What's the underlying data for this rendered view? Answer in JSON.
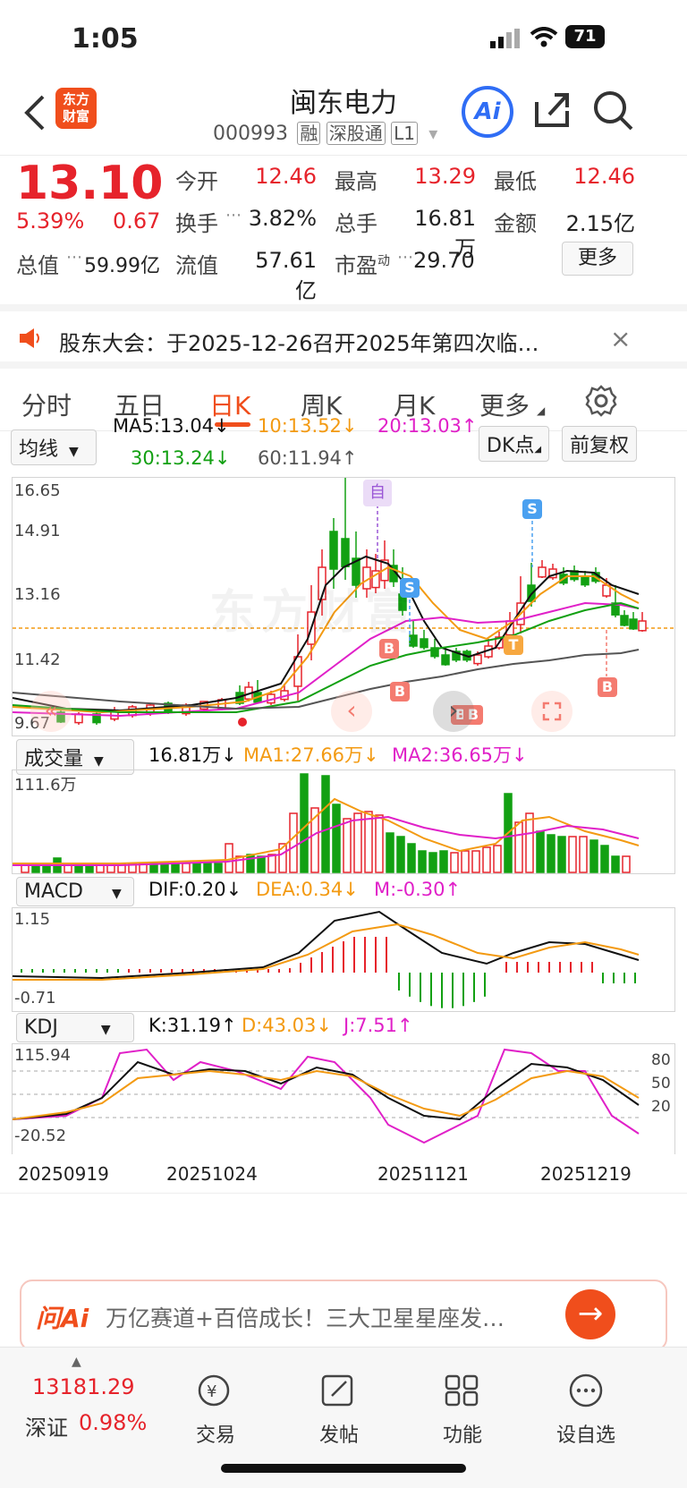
{
  "status": {
    "time": "1:05",
    "battery": "71"
  },
  "header": {
    "name": "闽东电力",
    "code": "000993",
    "tags": [
      "融",
      "深股通",
      "L1"
    ],
    "logo_text": "东方\n财富",
    "ai_label": "Ai"
  },
  "quote": {
    "price": "13.10",
    "change_pct": "5.39%",
    "change": "0.67",
    "stats": [
      {
        "label": "今开",
        "value": "12.46"
      },
      {
        "label": "最高",
        "value": "13.29"
      },
      {
        "label": "最低",
        "value": "12.46"
      },
      {
        "label": "换手",
        "value": "3.82%"
      },
      {
        "label": "总手",
        "value": "16.81万"
      },
      {
        "label": "金额",
        "value": "2.15亿"
      },
      {
        "label": "总值",
        "value": "59.99亿"
      },
      {
        "label": "流值",
        "value": "57.61亿"
      },
      {
        "label": "市盈",
        "value": "29.70",
        "sup": "动"
      }
    ],
    "more": "更多"
  },
  "notice": {
    "text": "股东大会：于2025-12-26召开2025年第四次临…"
  },
  "tabs": [
    "分时",
    "五日",
    "日K",
    "周K",
    "月K",
    "更多"
  ],
  "active_tab": "日K",
  "kline": {
    "selector": "均线",
    "dk": "DK点",
    "adjust": "前复权",
    "ma": [
      {
        "text": "MA5:13.04↓",
        "color": "#111111"
      },
      {
        "text": "10:13.52↓",
        "color": "#f39a12"
      },
      {
        "text": "20:13.03↑",
        "color": "#e020c8"
      },
      {
        "text": "30:13.24↓",
        "color": "#12a012"
      },
      {
        "text": "60:11.94↑",
        "color": "#555555"
      }
    ],
    "yticks": [
      "16.65",
      "14.91",
      "13.16",
      "11.42",
      "9.67"
    ],
    "markers": [
      "自",
      "S",
      "S",
      "B",
      "B",
      "B",
      "B",
      "T",
      "B"
    ],
    "watermark": "东方财富"
  },
  "volume": {
    "selector": "成交量",
    "labels": [
      {
        "text": "16.81万↓",
        "color": "#111111"
      },
      {
        "text": "MA1:27.66万↓",
        "color": "#f39a12"
      },
      {
        "text": "MA2:36.65万↓",
        "color": "#e020c8"
      }
    ],
    "ymax": "111.6万"
  },
  "macd": {
    "selector": "MACD",
    "labels": [
      {
        "text": "DIF:0.20↓",
        "color": "#111111"
      },
      {
        "text": "DEA:0.34↓",
        "color": "#f39a12"
      },
      {
        "text": "M:-0.30↑",
        "color": "#e020c8"
      }
    ],
    "ymax": "1.15",
    "ymin": "-0.71"
  },
  "kdj": {
    "selector": "KDJ",
    "labels": [
      {
        "text": "K:31.19↑",
        "color": "#111111"
      },
      {
        "text": "D:43.03↓",
        "color": "#f39a12"
      },
      {
        "text": "J:7.51↑",
        "color": "#e020c8"
      }
    ],
    "ymax": "115.94",
    "ymin": "-20.52",
    "levels": [
      "80",
      "50",
      "20"
    ]
  },
  "dates": [
    "20250919",
    "20251024",
    "20251121",
    "20251219"
  ],
  "ai_bar": {
    "logo": "问Ai",
    "text": "万亿赛道+百倍成长！三大卫星星座发…"
  },
  "index": {
    "value": "13181.29",
    "name": "深证",
    "pct": "0.98%"
  },
  "nav": [
    "交易",
    "发帖",
    "功能",
    "设自选"
  ]
}
